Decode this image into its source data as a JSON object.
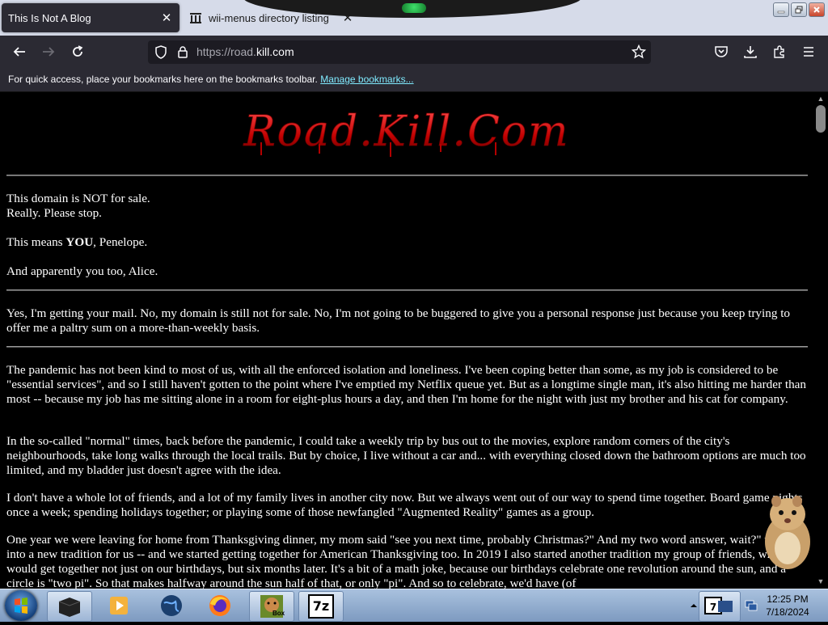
{
  "browser": {
    "tabs": [
      {
        "label": "This Is Not A Blog",
        "active": true
      },
      {
        "label": "wii-menus directory listing",
        "active": false
      }
    ],
    "url": {
      "prefix": "https://road.",
      "domain": "kill.com"
    },
    "bookmarks_bar": {
      "message": "For quick access, place your bookmarks here on the bookmarks toolbar.",
      "link": "Manage bookmarks..."
    }
  },
  "page": {
    "logo_text": "Road.Kill.Com",
    "para1_line1": "This domain is NOT for sale.",
    "para1_line2": "Really. Please stop.",
    "para2_pre": "This means ",
    "para2_bold": "YOU",
    "para2_post": ", Penelope.",
    "para3": "And apparently you too, Alice.",
    "para4": "Yes, I'm getting your mail. No, my domain is still not for sale. No, I'm not going to be buggered to give you a personal response just because you keep trying to offer me a paltry sum on a more-than-weekly basis.",
    "para5": "The pandemic has not been kind to most of us, with all the enforced isolation and loneliness. I've been coping better than some, as my job is considered to be \"essential services\", and so I still haven't gotten to the point where I've emptied my Netflix queue yet. But as a longtime single man, it's also hitting me harder than most -- because my job has me sitting alone in a room for eight-plus hours a day, and then I'm home for the night with just my brother and his cat for company.",
    "para6": "In the so-called \"normal\" times, back before the pandemic, I could take a weekly trip by bus out to the movies, explore random corners of the city's neighbourhoods, take long walks through the local trails. But by choice, I live without a car and... with everything closed down the bathroom options are much too limited, and my bladder just doesn't agree with the idea.",
    "para7": "I don't have a whole lot of friends, and a lot of my family lives in another city now. But we always went out of our way to spend time together. Board game nights once a week; spending holidays together; or playing some of those newfangled \"Augmented Reality\" games as a group.",
    "para8": "One year we were leaving for home from Thanksgiving dinner, my mom said \"see you next time, probably Christmas?\" And my two word answer, wait?\" turned into a new tradition for us -- and we started getting together for American Thanksgiving too. In 2019 I also started another tradition my group of friends, where we would get together not just on our birthdays, but six months later. It's a bit of a math joke, because our birthdays celebrate one revolution around the sun, and a circle is \"two pi\". So that makes halfway around the sun half of that, or only \"pi\". And so to celebrate, we'd have (of"
  },
  "taskbar": {
    "time": "12:25 PM",
    "date": "7/18/2024",
    "box_label": "Box",
    "sevenzip_label": "7z"
  }
}
